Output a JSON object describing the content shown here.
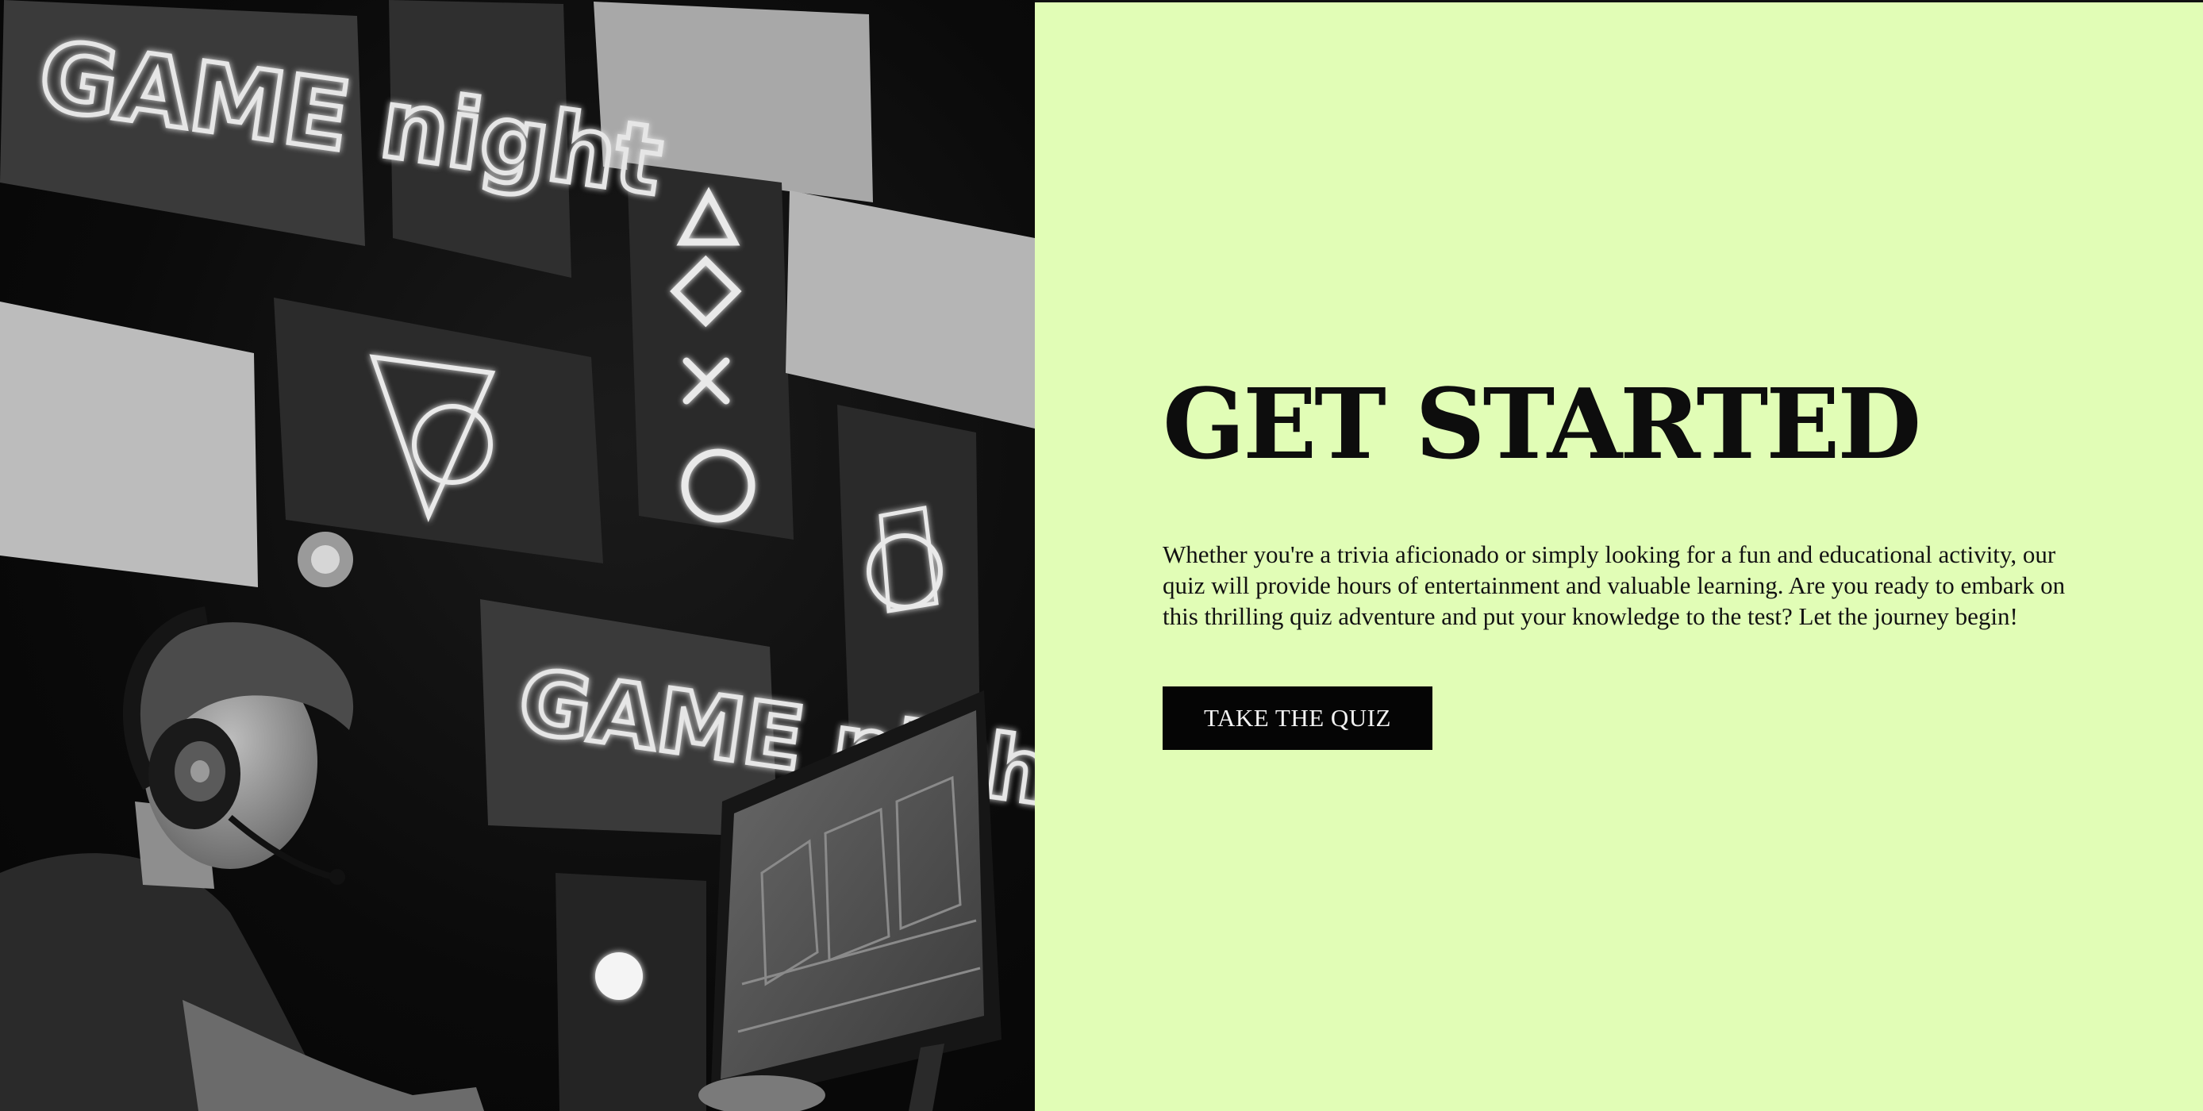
{
  "hero": {
    "title": "GET STARTED",
    "description": "Whether you're a trivia aficionado or simply looking for a fun and educational activity, our quiz will provide hours of entertainment and valuable learning. Are you ready to embark on this thrilling quiz adventure and put your knowledge to the test? Let the journey begin!",
    "cta_label": "TAKE THE QUIZ"
  },
  "image": {
    "neon_sign_top": "GAME night",
    "neon_sign_center": "GAME night"
  },
  "colors": {
    "panel_background": "#e1fdb6",
    "title": "#0d0d0d",
    "button_background": "#050505",
    "button_text": "#f2f2f2"
  }
}
